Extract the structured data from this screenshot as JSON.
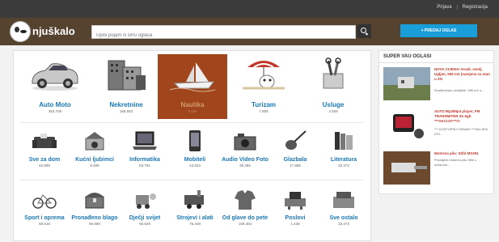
{
  "topbar": {
    "links": [
      "Prijava",
      "Registracija"
    ]
  },
  "header": {
    "logo_text": "njuškalo",
    "search_placeholder": "Upiši pojam ili šifru oglasa",
    "post_button": "+ PREDAJ OGLAS"
  },
  "big_categories": [
    {
      "name": "Auto Moto",
      "count": "383.705",
      "icon": "car-icon"
    },
    {
      "name": "Nekretnine",
      "count": "168.553",
      "icon": "buildings-icon"
    },
    {
      "name": "Nautika",
      "count": "9.404",
      "icon": "boat-icon",
      "active": true
    },
    {
      "name": "Turizam",
      "count": "7.806",
      "icon": "beach-icon"
    },
    {
      "name": "Usluge",
      "count": "4.509",
      "icon": "tools-icon"
    }
  ],
  "row2": [
    {
      "name": "Sve za dom",
      "count": "84.889",
      "icon": "sofa-icon"
    },
    {
      "name": "Kućni ljubimci",
      "count": "8.499",
      "icon": "pet-icon"
    },
    {
      "name": "Informatika",
      "count": "83.701",
      "icon": "laptop-icon"
    },
    {
      "name": "Mobiteli",
      "count": "43.823",
      "icon": "phone-icon"
    },
    {
      "name": "Audio Video Foto",
      "count": "35.485",
      "icon": "camera-icon"
    },
    {
      "name": "Glazbala",
      "count": "17.868",
      "icon": "guitar-icon"
    },
    {
      "name": "Literatura",
      "count": "32.372",
      "icon": "books-icon"
    }
  ],
  "row3": [
    {
      "name": "Sport i oprema",
      "count": "58.518",
      "icon": "bicycle-icon"
    },
    {
      "name": "Pronađeno blago",
      "count": "56.589",
      "icon": "treasure-icon"
    },
    {
      "name": "Dječji svijet",
      "count": "58.629",
      "icon": "toys-icon"
    },
    {
      "name": "Strojevi i alati",
      "count": "75.448",
      "icon": "machine-icon"
    },
    {
      "name": "Od glave do pete",
      "count": "109.464",
      "icon": "clothes-icon"
    },
    {
      "name": "Poslovi",
      "count": "1.436",
      "icon": "office-icon"
    },
    {
      "name": "Sve ostalo",
      "count": "33.473",
      "icon": "misc-icon"
    }
  ],
  "sidebar": {
    "title": "SUPER VAU OGLASI",
    "ads": [
      {
        "title": "NOVA CIJENA! Gradi. zemlj. Ugljan, 555 m2 (namjena za stan u ZG",
        "desc": "Građevinsko zemljište, 555 m2 u..."
      },
      {
        "title": "AUTO Mp3/Mp4 player, FM TRANSMITER do 6gb ***AKCIJA***!!!",
        "desc": "*** DOSTUPNO ODMAH ***SALJEM ISTI..."
      },
      {
        "title": "Motorna pila: Stihl MS291",
        "desc": "Prodajem motornu pilu Stihl u izvrsnom..."
      }
    ]
  }
}
